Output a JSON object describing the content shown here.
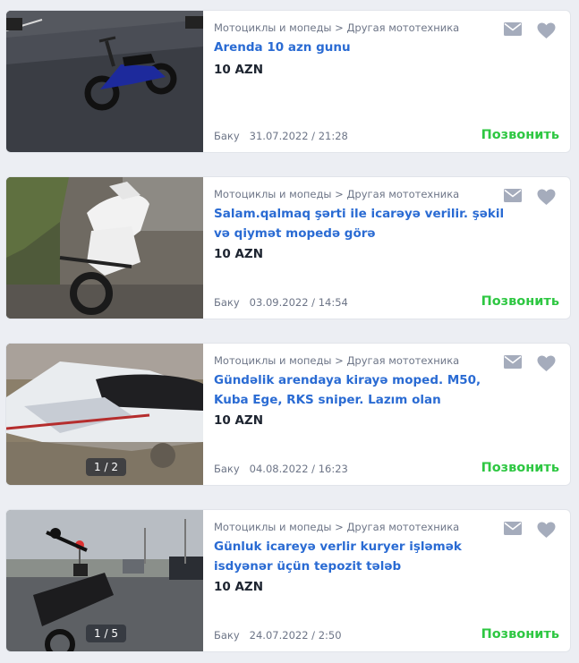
{
  "colors": {
    "link": "#2a6bd3",
    "call": "#2ec742",
    "muted": "#6d7587",
    "icon": "#a5acbc"
  },
  "icons": {
    "mail": "mail-icon",
    "favorite": "heart-icon"
  },
  "listings": [
    {
      "category": "Мотоциклы и мопеды > Другая мототехника",
      "title": "Arenda 10 azn gunu",
      "price": "10 AZN",
      "city": "Баку",
      "date": "31.07.2022 / 21:28",
      "call": "Позвонить",
      "photo_counter": ""
    },
    {
      "category": "Мотоциклы и мопеды > Другая мототехника",
      "title": "Salam.qalmaq şərti ile icarəyə verilir. şəkil və qiymət mopedə görə",
      "price": "10 AZN",
      "city": "Баку",
      "date": "03.09.2022 / 14:54",
      "call": "Позвонить",
      "photo_counter": ""
    },
    {
      "category": "Мотоциклы и мопеды > Другая мототехника",
      "title": "Gündəlik arendaya kirayə moped. M50, Kuba Ege, RKS sniper. Lazım olan",
      "price": "10 AZN",
      "city": "Баку",
      "date": "04.08.2022 / 16:23",
      "call": "Позвонить",
      "photo_counter": "1 / 2"
    },
    {
      "category": "Мотоциклы и мопеды > Другая мототехника",
      "title": "Günluk icareyə verlir kuryer işləmək isdyənər üçün tepozit tələb",
      "price": "10 AZN",
      "city": "Баку",
      "date": "24.07.2022 / 2:50",
      "call": "Позвонить",
      "photo_counter": "1 / 5"
    }
  ]
}
